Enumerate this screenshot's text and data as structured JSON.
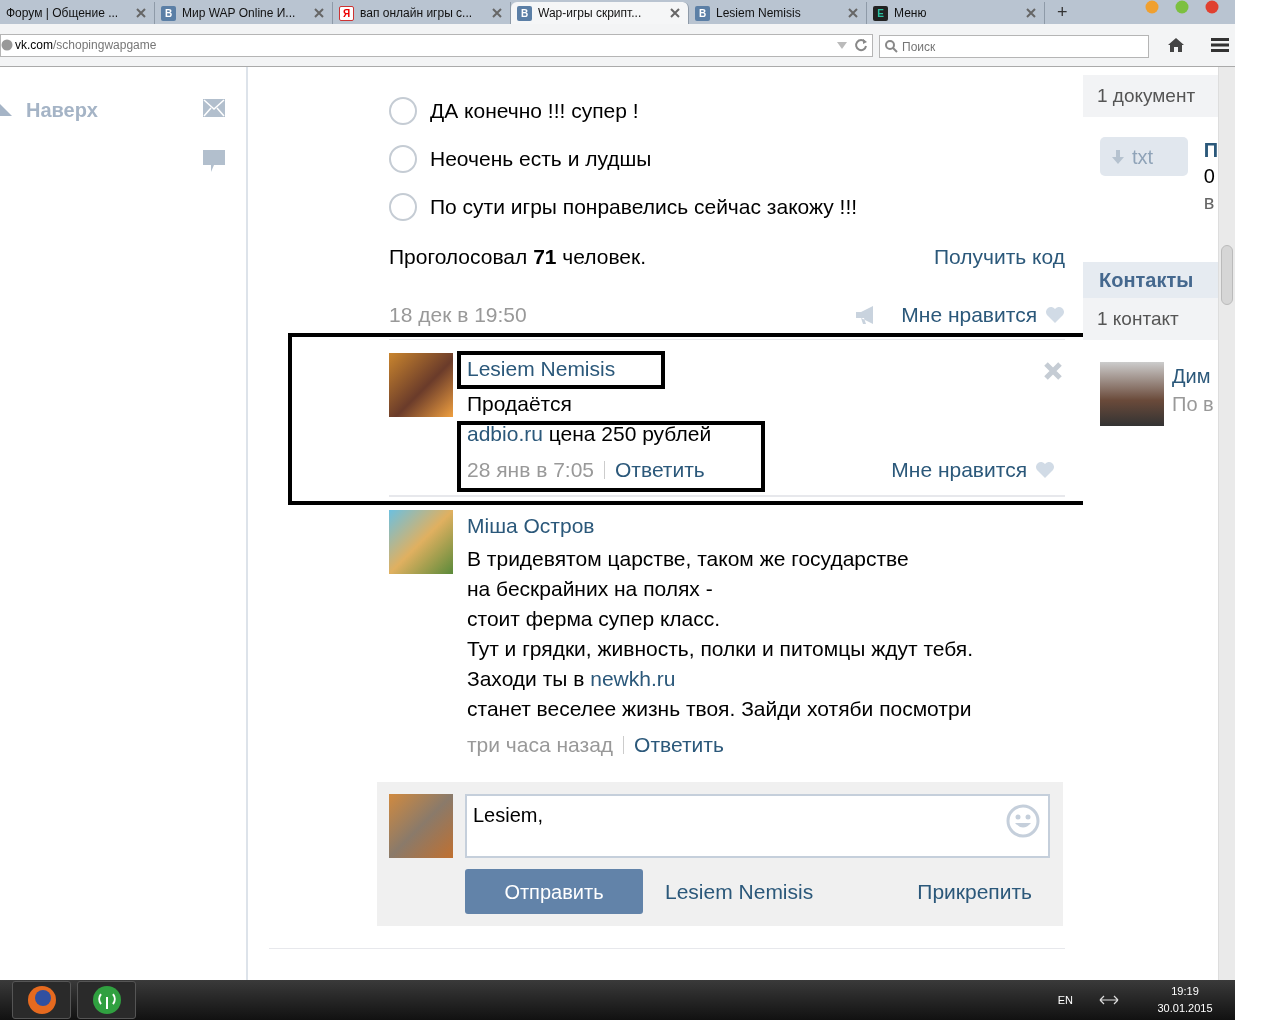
{
  "browser": {
    "tabs": [
      {
        "title": "Форум | Общение ...",
        "selected": false
      },
      {
        "title": "Мир WAP Online И...",
        "icon": {
          "kind": "vk",
          "letter": "B"
        },
        "selected": false
      },
      {
        "title": "вап онлайн игры с...",
        "icon": {
          "kind": "yandex",
          "letter": "Я"
        },
        "selected": false
      },
      {
        "title": "Wap-игры скрипт...",
        "icon": {
          "kind": "vk",
          "letter": "B"
        },
        "selected": true
      },
      {
        "title": "Lesiem Nemisis",
        "icon": {
          "kind": "vk",
          "letter": "B"
        },
        "selected": false
      },
      {
        "title": "Меню",
        "icon": {
          "kind": "dark",
          "letter": "E"
        },
        "selected": false
      }
    ],
    "new_tab": "+",
    "address": {
      "domain": "vk.com",
      "path": "/schopingwapgame"
    },
    "search": {
      "placeholder": "Поиск"
    }
  },
  "sidebar": {
    "up_link": "Наверх"
  },
  "poll": {
    "options": [
      {
        "label": "ДА конечно !!! супер !",
        "selected": false
      },
      {
        "label": "Неочень есть и лудшы",
        "selected": false
      },
      {
        "label": "По сути игры понравелись сейчас закожу !!!",
        "selected": false
      }
    ],
    "votes": "Проголосовал **71** человек.",
    "get_code": "Получить код",
    "date": "18 дек в 19:50",
    "like": "Мне нравится"
  },
  "comments": [
    {
      "author": "Lesiem Nemisis",
      "framed": true,
      "lines": [
        [
          {
            "kind": "plain",
            "text": "Продаётся"
          }
        ],
        [
          {
            "kind": "link",
            "text": "adbio.ru"
          },
          {
            "kind": "plain",
            "text": " цена 250 рублей"
          }
        ]
      ],
      "date": "28 янв в 7:05",
      "reply": "Ответить",
      "like": "Мне нравится",
      "deletable": true
    },
    {
      "author": "Міша Остров",
      "framed": false,
      "lines": [
        [
          {
            "kind": "plain",
            "text": "В тридевятом царстве, таком же государстве"
          }
        ],
        [
          {
            "kind": "plain",
            "text": "на бескрайних на полях -"
          }
        ],
        [
          {
            "kind": "plain",
            "text": "стоит ферма супер класс."
          }
        ],
        [
          {
            "kind": "plain",
            "text": "Тут и грядки, живность, полки и питомцы ждут тебя."
          }
        ],
        [
          {
            "kind": "plain",
            "text": "Заходи ты в "
          },
          {
            "kind": "link",
            "text": "newkh.ru"
          }
        ],
        [
          {
            "kind": "plain",
            "text": "станет веселее жизнь твоя. Зайди хотяби посмотри"
          }
        ]
      ],
      "date": "три часа назад",
      "reply": "Ответить",
      "deletable": false
    }
  ],
  "reply_form": {
    "value": "Lesiem, ",
    "send": "Отправить",
    "author": "Lesiem Nemisis",
    "attach": "Прикрепить"
  },
  "right_column": {
    "docs_count": "1 документ",
    "doc_type": "txt",
    "doc_title": "П",
    "doc_size": "0",
    "doc_date": "в",
    "contacts_title": "Контакты",
    "contacts_count": "1 контакт",
    "contact_name": "Дим",
    "contact_role": "По в"
  },
  "taskbar": {
    "language": "EN",
    "time": "19:19",
    "date": "30.01.2015"
  }
}
